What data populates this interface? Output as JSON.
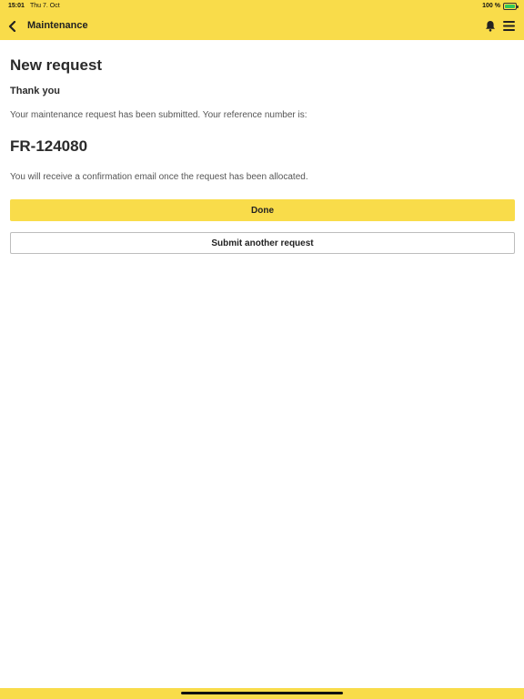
{
  "status_bar": {
    "time": "15:01",
    "date": "Thu 7. Oct",
    "battery": "100 %"
  },
  "nav": {
    "back_icon": "chevron-left-icon",
    "title": "Maintenance",
    "bell_icon": "bell-icon",
    "menu_icon": "hamburger-menu-icon"
  },
  "content": {
    "title": "New request",
    "thank_you": "Thank you",
    "message": "Your maintenance request has been submitted. Your reference number is:",
    "reference": "FR-124080",
    "confirmation": "You will receive a confirmation email once the request has been allocated."
  },
  "actions": {
    "done_label": "Done",
    "another_label": "Submit another request"
  },
  "colors": {
    "accent": "#f9dc4a",
    "battery": "#34c759"
  }
}
